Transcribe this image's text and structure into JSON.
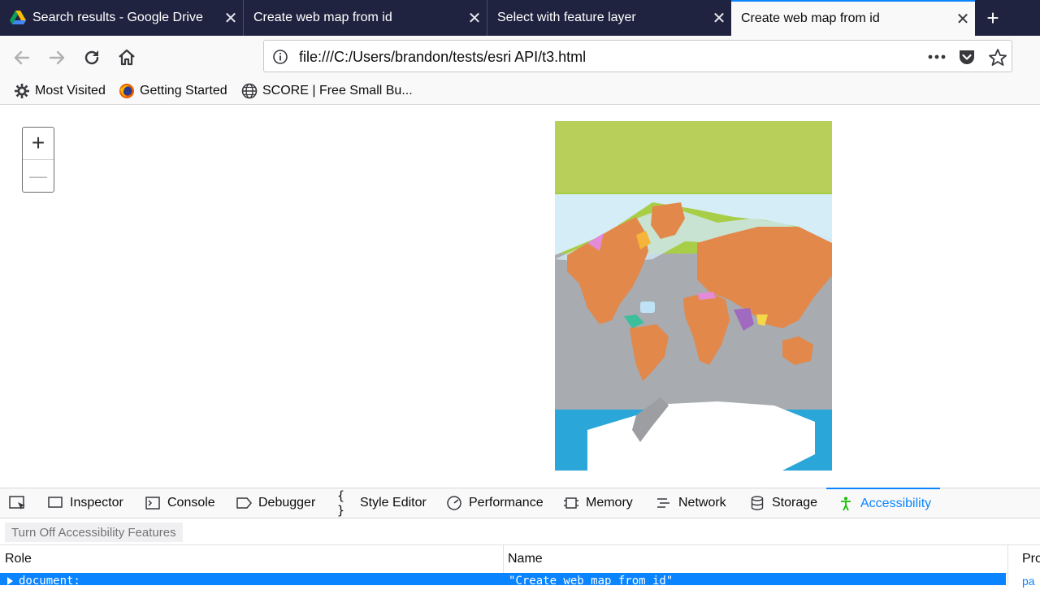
{
  "tabs": [
    {
      "title": "Search results - Google Drive",
      "close": "✕"
    },
    {
      "title": "Create web map from id",
      "close": "✕"
    },
    {
      "title": "Select with feature layer",
      "close": "✕"
    },
    {
      "title": "Create web map from id",
      "close": "✕"
    }
  ],
  "new_tab": "+",
  "url": "file:///C:/Users/brandon/tests/esri API/t3.html",
  "bookmarks": [
    {
      "label": "Most Visited"
    },
    {
      "label": "Getting Started"
    },
    {
      "label": "SCORE | Free Small Bu..."
    }
  ],
  "zoom": {
    "in": "+",
    "out": "—"
  },
  "devtools": {
    "tabs": [
      "Inspector",
      "Console",
      "Debugger",
      "Style Editor",
      "Performance",
      "Memory",
      "Network",
      "Storage",
      "Accessibility"
    ],
    "active_tab": "Accessibility",
    "toggle_button": "Turn Off Accessibility Features",
    "columns": {
      "role": "Role",
      "name": "Name",
      "props": "Pro"
    },
    "selected_row": {
      "role": "document:",
      "name": "\"Create web map from id\"",
      "props": "pa"
    }
  },
  "colors": {
    "accent": "#0a84ff",
    "tabstrip": "#202340",
    "land": "#e2884a",
    "ocean": "#a8abaf",
    "top_band": "#b8d05a",
    "antarctic_water": "#2aa7d8"
  }
}
